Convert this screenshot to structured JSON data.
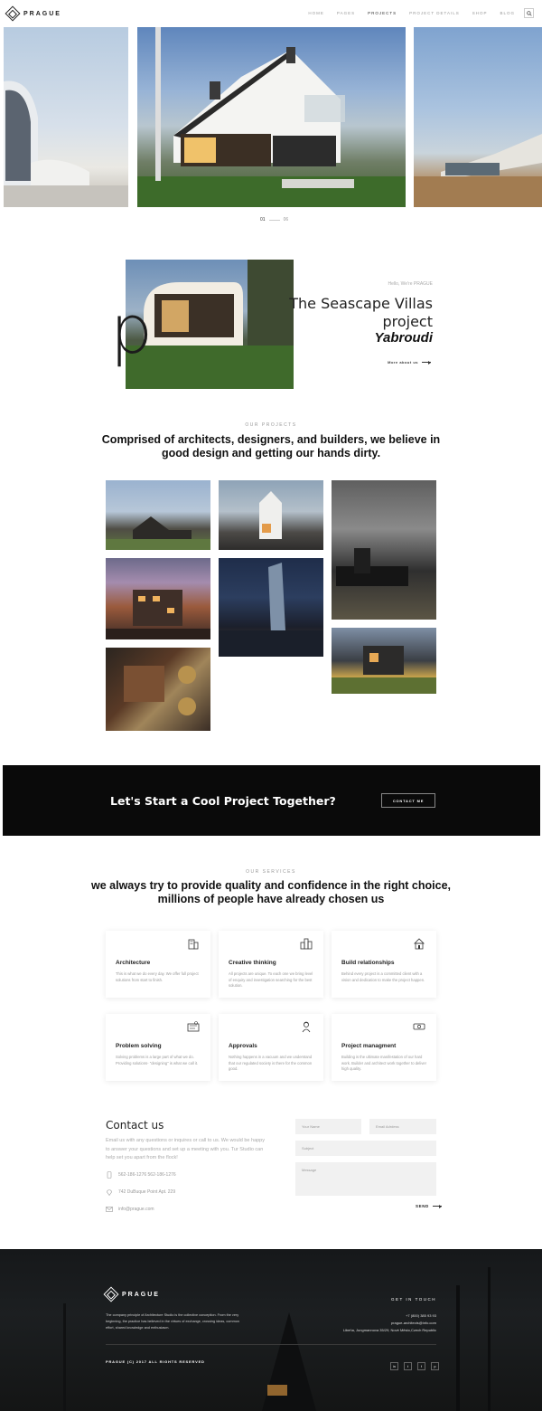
{
  "header": {
    "logo_text": "PRAGUE",
    "nav": [
      "HOME",
      "PAGES",
      "PROJECTS",
      "PROJECT DETAILS",
      "SHOP",
      "BLOG"
    ],
    "active_nav": "PROJECTS",
    "search_icon": "search-icon"
  },
  "slider": {
    "current": "01",
    "total": "06"
  },
  "about": {
    "big_letter": "p",
    "eyebrow": "Hello, We're PRAGUE",
    "title": "The Seascape Villas project",
    "subtitle": "Yabroudi",
    "more_label": "More about us"
  },
  "projects": {
    "eyebrow": "OUR PROJECTS",
    "title": "Comprised of architects, designers, and builders, we believe in good design and getting our hands dirty."
  },
  "cta": {
    "text": "Let's Start a Cool Project Together?",
    "button": "CONTACT ME"
  },
  "services": {
    "eyebrow": "OUR SERVICES",
    "title": "we always try to provide quality and confidence in the right choice, millions of people have already chosen us",
    "cards": [
      {
        "title": "Architecture",
        "desc": "This is what we do every day. We offer full project solutions from start to finish.",
        "icon": "building-icon"
      },
      {
        "title": "Creative thinking",
        "desc": "All projects are unique. To each one we bring level of enquiry and investigation searching for the best solution.",
        "icon": "city-icon"
      },
      {
        "title": "Build relationships",
        "desc": "Behind every project is a committed client with a vision and dedication to make the project happen.",
        "icon": "house-icon"
      },
      {
        "title": "Problem solving",
        "desc": "Solving problems is a large part of what we do. Providing solutions- \"designing\" is what we call it.",
        "icon": "blueprint-icon"
      },
      {
        "title": "Approvals",
        "desc": "Nothing happens in a vacuum and we understand that our regulated society is there for the common good.",
        "icon": "worker-icon"
      },
      {
        "title": "Project managment",
        "desc": "Building is the ultimate manifestation of our hard work. Builder and architect work together to deliver high quality.",
        "icon": "money-icon"
      }
    ]
  },
  "contact": {
    "title": "Contact us",
    "desc": "Email us with any questions or inquires or call to us. We would be happy to answer your questions and set up a meeting with you. Tur Studio can help set you apart from the flock!",
    "phone": "562-186-1276    562-186-1276",
    "address": "742 DuBuque Point Apt. 229",
    "email": "info@prague.com",
    "form": {
      "name_placeholder": "Your Name",
      "email_placeholder": "Email Adrdess",
      "subject_placeholder": "Subject",
      "message_placeholder": "Message",
      "send_label": "SEND"
    }
  },
  "footer": {
    "logo_text": "PRAGUE",
    "desc": "The company principle of Architecture Studio is the collective conception. From the very beginning, the practice has believed in the virtues of exchange, crossing ideas, common effort, shared knowledge and enthusiasm.",
    "get_in_touch": "GET IN TOUCH",
    "phone": "+7 (800) 385 93 93",
    "email": "prague-architects@info.com",
    "address": "Libeňa, Jungmannova 35/29, Nové Město,Czech Republic",
    "copyright": "PRAGUE (C) 2017 ALL RIGHTS RESERVED",
    "socials": [
      "in",
      "t",
      "f",
      "p"
    ]
  }
}
